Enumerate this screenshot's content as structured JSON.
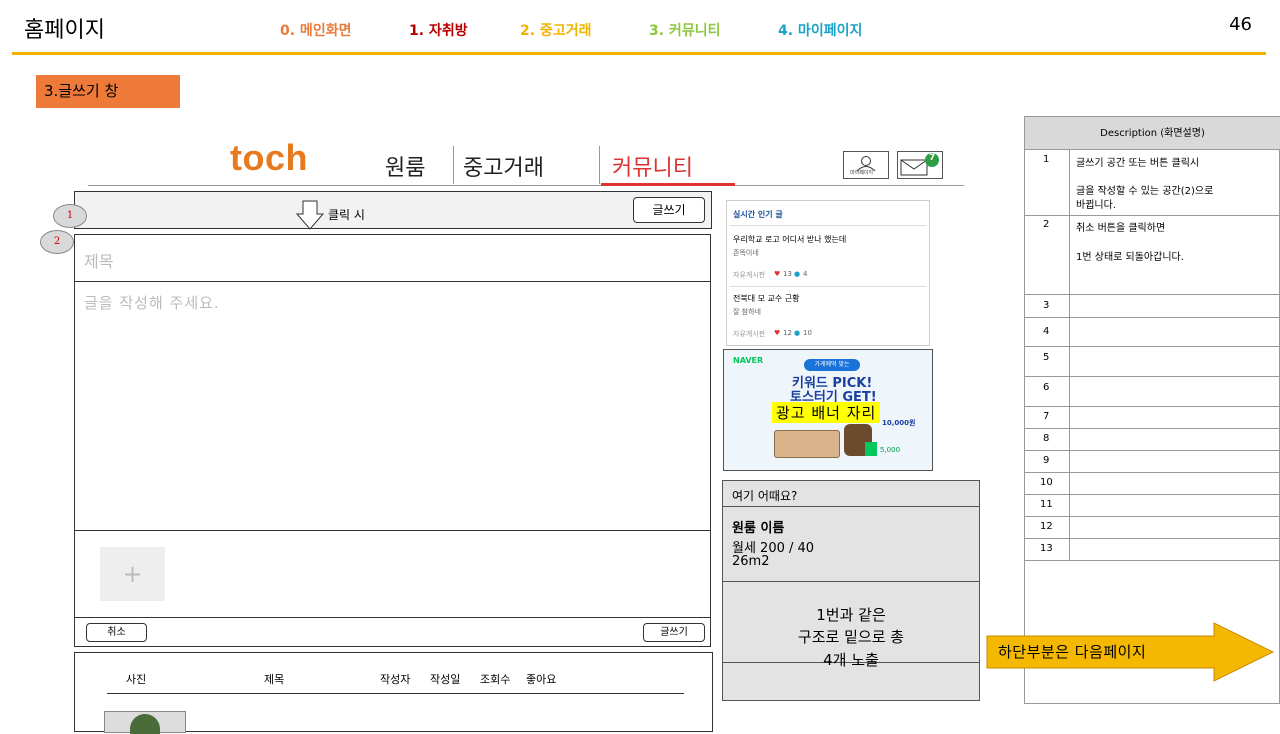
{
  "header": {
    "title": "홈페이지",
    "nav": [
      {
        "label": "0. 메인화면",
        "color": "#e87a3a"
      },
      {
        "label": "1. 자취방",
        "color": "#b80000"
      },
      {
        "label": "2. 중고거래",
        "color": "#f0b400"
      },
      {
        "label": "3. 커뮤니티",
        "color": "#8dc63f"
      },
      {
        "label": "4. 마이페이지",
        "color": "#1aa3c8"
      }
    ],
    "page_number": "46",
    "accent_line_color": "#f0b400"
  },
  "section_label": "3.글쓰기 창",
  "site": {
    "logo": "toch",
    "tabs": [
      "원룸",
      "중고거래",
      "커뮤니티"
    ],
    "active_tab": "커뮤니티",
    "mypage_label": "마이페이지",
    "mail_badge": "7"
  },
  "compose": {
    "click_hint": "클릭 시",
    "write_button": "글쓰기",
    "marker1": "1",
    "marker2": "2",
    "title_placeholder": "제목",
    "body_placeholder": "글을 작성해 주세요.",
    "add_photo_symbol": "+",
    "cancel_button": "취소",
    "submit_button": "글쓰기"
  },
  "list_header": {
    "columns": [
      "사진",
      "제목",
      "작성자",
      "작성일",
      "조회수",
      "좋아요"
    ]
  },
  "popular": {
    "title": "실시간 인기 글",
    "posts": [
      {
        "title": "우리학교 로고 어디서 받나 했는데",
        "sub": "존똑이네",
        "board": "자유게시판",
        "likes": "13",
        "comments": "4"
      },
      {
        "title": "전북대 모 교수 근황",
        "sub": "잘 참하네",
        "board": "자유게시판",
        "likes": "12",
        "comments": "10"
      }
    ]
  },
  "ad": {
    "brand": "NAVER",
    "pill": "가게에딱 맞는",
    "headline1": "키워드 PICK!",
    "headline2": "토스터기 GET!",
    "amount": "10,000원",
    "price": "5,000",
    "overlay": "광고 배너 자리"
  },
  "recommend": {
    "title": "여기 어때요?",
    "name": "원룸 이름",
    "rent": "월세 200 / 40",
    "size": "26m2",
    "note_line1": "1번과 같은",
    "note_line2": "구조로 밑으로 총",
    "note_line3": "4개 노출"
  },
  "description": {
    "header": "Description (화면설명)",
    "rows": [
      {
        "num": "1",
        "text1": "글쓰기 공간 또는 버튼 클릭시",
        "text2": "글을 작성할 수 있는 공간(2)으로",
        "text3": "바뀝니다."
      },
      {
        "num": "2",
        "text1": "취소 버튼을 클릭하면",
        "text2": "1번 상태로 되돌아갑니다.",
        "text3": ""
      },
      {
        "num": "3"
      },
      {
        "num": "4"
      },
      {
        "num": "5"
      },
      {
        "num": "6"
      },
      {
        "num": "7"
      },
      {
        "num": "8"
      },
      {
        "num": "9"
      },
      {
        "num": "10"
      },
      {
        "num": "11"
      },
      {
        "num": "12"
      },
      {
        "num": "13"
      }
    ]
  },
  "next_arrow": {
    "label": "하단부분은 다음페이지",
    "color": "#f5b800"
  }
}
